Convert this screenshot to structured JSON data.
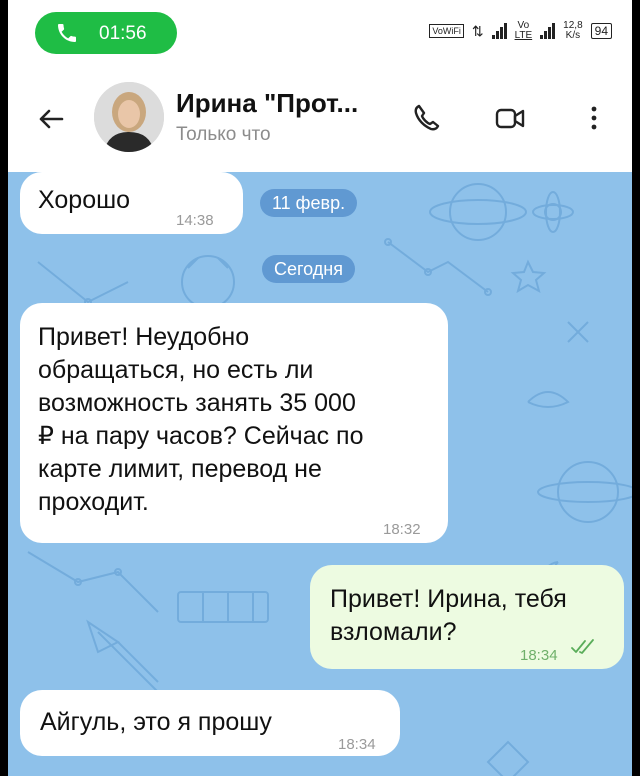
{
  "status_bar": {
    "call_time": "01:56",
    "vowifi": "VoWiFi",
    "lte_top": "Vo",
    "lte_bottom": "LTE",
    "speed_top": "12,8",
    "speed_bottom": "K/s",
    "battery": "94"
  },
  "header": {
    "contact_name": "Ирина \"Прот...",
    "last_seen": "Только что"
  },
  "chat": {
    "date_pills": [
      "11 февр.",
      "Сегодня"
    ],
    "messages": [
      {
        "direction": "in",
        "text": "Хорошо",
        "time": "14:38"
      },
      {
        "direction": "in",
        "lines": [
          "Привет! Неудобно",
          "обращаться, но есть ли",
          "возможность занять 35 000",
          "₽ на пару часов? Сейчас по",
          "карте лимит, перевод не",
          "проходит."
        ],
        "time": "18:32"
      },
      {
        "direction": "out",
        "lines": [
          "Привет! Ирина, тебя",
          "взломали?"
        ],
        "time": "18:34",
        "read": true
      },
      {
        "direction": "in",
        "text": "Айгуль, это я прошу",
        "time": "18:34"
      }
    ]
  },
  "colors": {
    "call_pill": "#1fbd45",
    "chat_bg": "#8ec1ea",
    "incoming_bubble": "#ffffff",
    "outgoing_bubble": "#edfbe1",
    "read_check": "#5aad5a"
  },
  "icons": [
    "phone-icon",
    "back-arrow-icon",
    "call-icon",
    "video-call-icon",
    "more-vertical-icon",
    "read-check-icon"
  ]
}
